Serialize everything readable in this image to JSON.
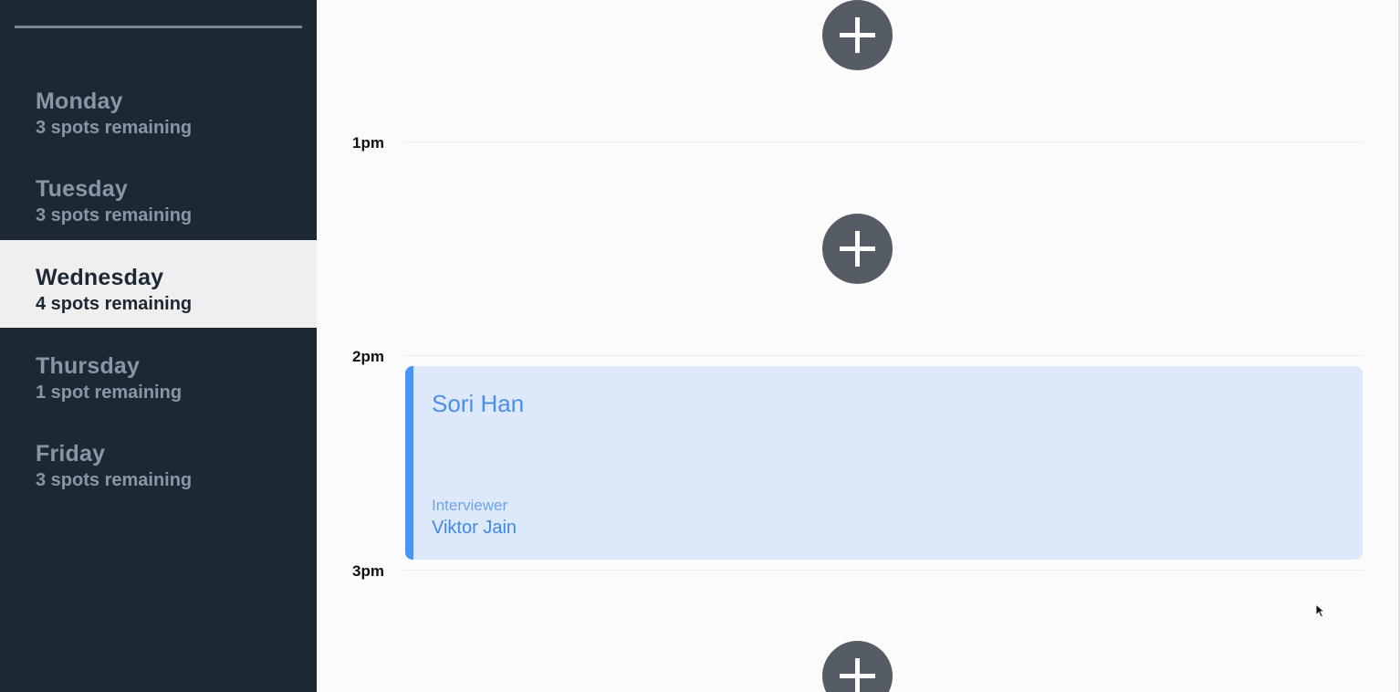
{
  "sidebar": {
    "days": [
      {
        "name": "Monday",
        "spots": "3 spots remaining",
        "active": false
      },
      {
        "name": "Tuesday",
        "spots": "3 spots remaining",
        "active": false
      },
      {
        "name": "Wednesday",
        "spots": "4 spots remaining",
        "active": true
      },
      {
        "name": "Thursday",
        "spots": "1 spot remaining",
        "active": false
      },
      {
        "name": "Friday",
        "spots": "3 spots remaining",
        "active": false
      }
    ]
  },
  "schedule": {
    "hours": [
      "1pm",
      "2pm",
      "3pm"
    ],
    "booking": {
      "candidate": "Sori Han",
      "interviewer_label": "Interviewer",
      "interviewer": "Viktor Jain"
    },
    "add_icon": "plus-icon"
  },
  "colors": {
    "sidebar_bg": "#1c2834",
    "active_item_bg": "#efefef",
    "booking_bg": "#dde9fb",
    "booking_accent": "#4b95f2",
    "add_button_bg": "#555c66"
  }
}
